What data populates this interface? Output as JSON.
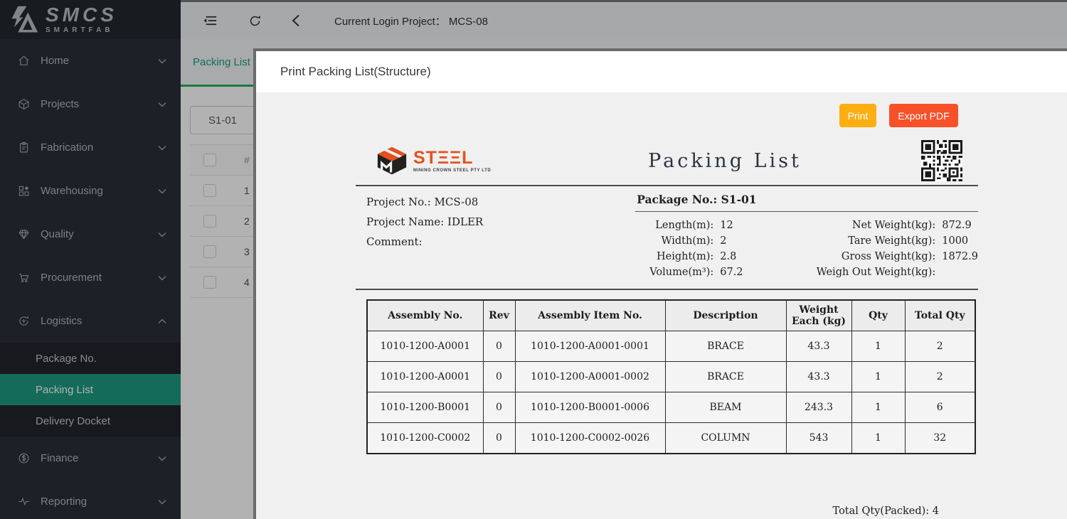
{
  "colors": {
    "accent_teal": "#1e9a80",
    "tab_green": "#27ae60",
    "print_button": "#fcae13",
    "export_button": "#f7512a",
    "logo_orange": "#e4511f",
    "sidebar_bg": "#2a2f37"
  },
  "sidebar": {
    "logo_title": "SMCS",
    "logo_subtitle": "SMARTFAB",
    "items": [
      {
        "label": "Home"
      },
      {
        "label": "Projects"
      },
      {
        "label": "Fabrication"
      },
      {
        "label": "Warehousing"
      },
      {
        "label": "Quality"
      },
      {
        "label": "Procurement"
      },
      {
        "label": "Logistics"
      },
      {
        "label": "Finance"
      },
      {
        "label": "Reporting"
      }
    ],
    "logistics_children": [
      {
        "label": "Package No."
      },
      {
        "label": "Packing List"
      },
      {
        "label": "Delivery Docket"
      }
    ]
  },
  "topbar": {
    "project_label": "Current Login Project：",
    "project_value": "MCS-08"
  },
  "background": {
    "tab_label": "Packing List",
    "package_select": "S1-01",
    "col_header": "#",
    "rows": [
      "1",
      "2",
      "3",
      "4"
    ]
  },
  "modal": {
    "title": "Print Packing List(Structure)",
    "buttons": {
      "print": "Print",
      "export": "Export PDF"
    },
    "doc": {
      "logo_text": "STΞΞL",
      "logo_subtext": "MINING CROWN STEEL PTY LTD",
      "title": "Packing List",
      "info_left": [
        {
          "label": "Project No.:",
          "value": "MCS-08"
        },
        {
          "label": "Project Name:",
          "value": "IDLER"
        },
        {
          "label": "Comment:",
          "value": ""
        }
      ],
      "package_label": "Package No.:",
      "package_value": "S1-01",
      "dims": [
        {
          "label": "Length(m):",
          "value": "12"
        },
        {
          "label": "Width(m):",
          "value": "2"
        },
        {
          "label": "Height(m):",
          "value": "2.8"
        },
        {
          "label": "Volume(m³):",
          "value": "67.2"
        }
      ],
      "weights": [
        {
          "label": "Net Weight(kg):",
          "value": "872.9"
        },
        {
          "label": "Tare Weight(kg):",
          "value": "1000"
        },
        {
          "label": "Gross Weight(kg):",
          "value": "1872.9"
        },
        {
          "label": "Weigh Out Weight(kg):",
          "value": ""
        }
      ],
      "table": {
        "headers": [
          "Assembly No.",
          "Rev",
          "Assembly Item No.",
          "Description",
          "Weight Each (kg)",
          "Qty",
          "Total Qty"
        ],
        "rows": [
          [
            "1010-1200-A0001",
            "0",
            "1010-1200-A0001-0001",
            "BRACE",
            "43.3",
            "1",
            "2"
          ],
          [
            "1010-1200-A0001",
            "0",
            "1010-1200-A0001-0002",
            "BRACE",
            "43.3",
            "1",
            "2"
          ],
          [
            "1010-1200-B0001",
            "0",
            "1010-1200-B0001-0006",
            "BEAM",
            "243.3",
            "1",
            "6"
          ],
          [
            "1010-1200-C0002",
            "0",
            "1010-1200-C0002-0026",
            "COLUMN",
            "543",
            "1",
            "32"
          ]
        ]
      },
      "total_label": "Total Qty(Packed):",
      "total_value": "4"
    }
  }
}
